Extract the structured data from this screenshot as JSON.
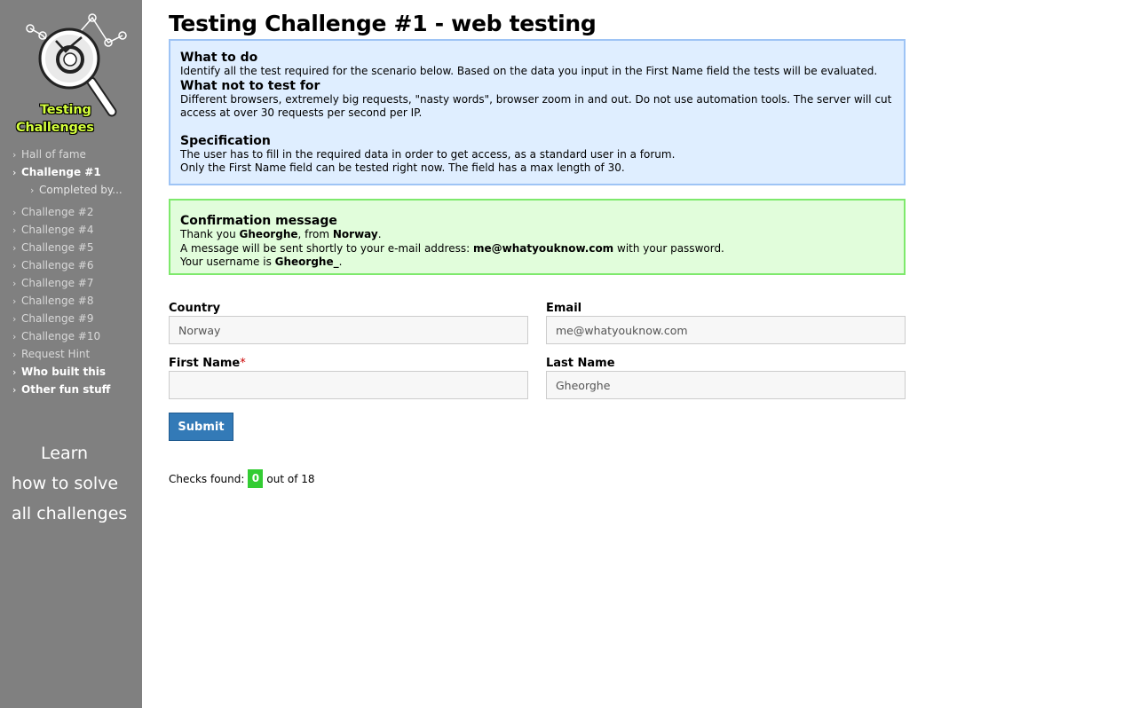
{
  "logo": {
    "line1": "Testing",
    "line2": "Challenges"
  },
  "sidebar": {
    "items": [
      {
        "label": "Hall of fame"
      },
      {
        "label": "Challenge #1"
      },
      {
        "label": "Completed by..."
      },
      {
        "label": "Challenge #2"
      },
      {
        "label": "Challenge #4"
      },
      {
        "label": "Challenge #5"
      },
      {
        "label": "Challenge #6"
      },
      {
        "label": "Challenge #7"
      },
      {
        "label": "Challenge #8"
      },
      {
        "label": "Challenge #9"
      },
      {
        "label": "Challenge #10"
      },
      {
        "label": "Request Hint"
      },
      {
        "label": "Who built this"
      },
      {
        "label": "Other fun stuff"
      }
    ],
    "learn": {
      "line1": "Learn",
      "line2": "how to solve",
      "line3": "all challenges"
    }
  },
  "page": {
    "title": "Testing Challenge #1 - web testing"
  },
  "info": {
    "what_to_do_title": "What to do",
    "what_to_do_text": "Identify all the test required for the scenario below. Based on the data you input in the First Name field the tests will be evaluated.",
    "what_not_title": "What not to test for",
    "what_not_text": "Different browsers, extremely big requests, \"nasty words\", browser zoom in and out. Do not use automation tools. The server will cut access at over 30 requests per second per IP.",
    "spec_title": "Specification",
    "spec_line1": "The user has to fill in the required data in order to get access, as a standard user in a forum.",
    "spec_line2": "Only the First Name field can be tested right now. The field has a max length of 30."
  },
  "confirmation": {
    "title": "Confirmation message",
    "thank_prefix": "Thank you ",
    "name": "Gheorghe",
    "from_text": ", from ",
    "country": "Norway",
    "period": ".",
    "msg_prefix": "A message will be sent shortly to your e-mail address: ",
    "email": "me@whatyouknow.com",
    "msg_suffix": " with your password.",
    "username_prefix": "Your username is ",
    "username": "Gheorghe_",
    "username_suffix": "."
  },
  "form": {
    "country_label": "Country",
    "country_value": "Norway",
    "email_label": "Email",
    "email_value": "me@whatyouknow.com",
    "first_name_label": "First Name",
    "required_mark": "*",
    "first_name_value": "",
    "last_name_label": "Last Name",
    "last_name_value": "Gheorghe",
    "submit_label": "Submit"
  },
  "checks": {
    "prefix": "Checks found:",
    "found": "0",
    "suffix": "out of 18"
  },
  "colors": {
    "sidebar_bg": "#808080",
    "info_bg": "#dfeeff",
    "info_border": "#9ec4f5",
    "confirm_bg": "#e1fddb",
    "confirm_border": "#7ee96c",
    "submit_bg": "#337ab7",
    "badge_bg": "#33cc33",
    "logo_text": "#d4ff3c"
  }
}
